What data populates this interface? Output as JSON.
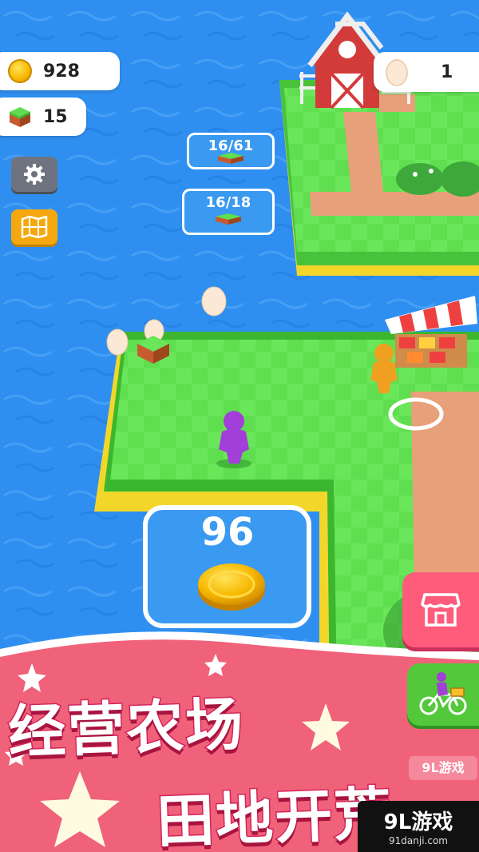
{
  "hud": {
    "coins": "928",
    "blocks": "15",
    "eggs": "1"
  },
  "tiles": {
    "top_tile_count": "16/61",
    "mid_tile_count": "16/18",
    "unlock_cost": "96"
  },
  "banner": {
    "line1": "经营农场",
    "line2": "田地开荒"
  },
  "watermark": {
    "brand": "9L游戏",
    "url": "91danji.com"
  },
  "icons": {
    "settings": "gear-icon",
    "map": "map-icon",
    "shop": "shop-icon",
    "bike": "bike-icon",
    "coin": "coin-icon",
    "egg": "egg-icon",
    "grass_block": "grass-block-icon"
  },
  "colors": {
    "water": "#2f8ff0",
    "grass": "#5fde4f",
    "path": "#e8a07a",
    "banner_pink": "#f0627a",
    "shop_button": "#ff5c7c",
    "bike_button": "#52c83a"
  }
}
